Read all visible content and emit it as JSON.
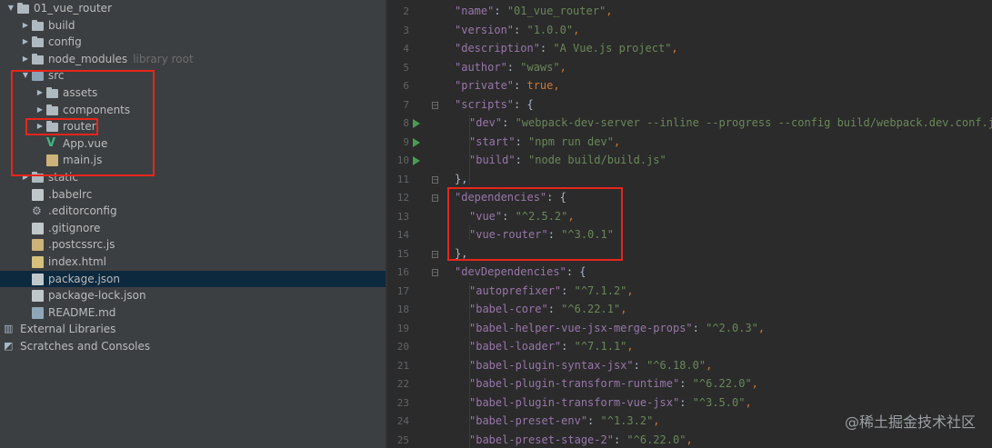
{
  "project_tree": {
    "items": [
      {
        "label": "01_vue_router",
        "depth": 0,
        "arrow": "down",
        "icon": "folder",
        "suffix": ""
      },
      {
        "label": "build",
        "depth": 1,
        "arrow": "right",
        "icon": "folder",
        "suffix": ""
      },
      {
        "label": "config",
        "depth": 1,
        "arrow": "right",
        "icon": "folder",
        "suffix": ""
      },
      {
        "label": "node_modules",
        "depth": 1,
        "arrow": "right",
        "icon": "folder",
        "suffix": "library root"
      },
      {
        "label": "src",
        "depth": 1,
        "arrow": "down",
        "icon": "folder-src",
        "suffix": ""
      },
      {
        "label": "assets",
        "depth": 2,
        "arrow": "right",
        "icon": "folder",
        "suffix": ""
      },
      {
        "label": "components",
        "depth": 2,
        "arrow": "right",
        "icon": "folder",
        "suffix": ""
      },
      {
        "label": "router",
        "depth": 2,
        "arrow": "right",
        "icon": "folder",
        "suffix": ""
      },
      {
        "label": "App.vue",
        "depth": 2,
        "arrow": "",
        "icon": "vue",
        "suffix": ""
      },
      {
        "label": "main.js",
        "depth": 2,
        "arrow": "",
        "icon": "js",
        "suffix": ""
      },
      {
        "label": "static",
        "depth": 1,
        "arrow": "right",
        "icon": "folder",
        "suffix": ""
      },
      {
        "label": ".babelrc",
        "depth": 1,
        "arrow": "",
        "icon": "json",
        "suffix": ""
      },
      {
        "label": ".editorconfig",
        "depth": 1,
        "arrow": "",
        "icon": "gear",
        "suffix": ""
      },
      {
        "label": ".gitignore",
        "depth": 1,
        "arrow": "",
        "icon": "json",
        "suffix": ""
      },
      {
        "label": ".postcssrc.js",
        "depth": 1,
        "arrow": "",
        "icon": "js",
        "suffix": ""
      },
      {
        "label": "index.html",
        "depth": 1,
        "arrow": "",
        "icon": "html",
        "suffix": ""
      },
      {
        "label": "package.json",
        "depth": 1,
        "arrow": "",
        "icon": "json",
        "suffix": "",
        "selected": true
      },
      {
        "label": "package-lock.json",
        "depth": 1,
        "arrow": "",
        "icon": "json",
        "suffix": ""
      },
      {
        "label": "README.md",
        "depth": 1,
        "arrow": "",
        "icon": "md",
        "suffix": ""
      },
      {
        "label": "External Libraries",
        "depth": 0,
        "arrow": "",
        "icon": "library",
        "suffix": ""
      },
      {
        "label": "Scratches and Consoles",
        "depth": 0,
        "arrow": "",
        "icon": "scratch",
        "suffix": ""
      }
    ]
  },
  "editor": {
    "lines": [
      {
        "n": "2",
        "tokens": [
          [
            "k",
            "\"name\""
          ],
          [
            "p",
            ": "
          ],
          [
            "s",
            "\"01_vue_router\""
          ],
          [
            "b",
            ","
          ]
        ],
        "indent": 1
      },
      {
        "n": "3",
        "tokens": [
          [
            "k",
            "\"version\""
          ],
          [
            "p",
            ": "
          ],
          [
            "s",
            "\"1.0.0\""
          ],
          [
            "b",
            ","
          ]
        ],
        "indent": 1
      },
      {
        "n": "4",
        "tokens": [
          [
            "k",
            "\"description\""
          ],
          [
            "p",
            ": "
          ],
          [
            "s",
            "\"A Vue.js project\""
          ],
          [
            "b",
            ","
          ]
        ],
        "indent": 1
      },
      {
        "n": "5",
        "tokens": [
          [
            "k",
            "\"author\""
          ],
          [
            "p",
            ": "
          ],
          [
            "s",
            "\"waws\""
          ],
          [
            "b",
            ","
          ]
        ],
        "indent": 1
      },
      {
        "n": "6",
        "tokens": [
          [
            "k",
            "\"private\""
          ],
          [
            "p",
            ": "
          ],
          [
            "b",
            "true,"
          ]
        ],
        "indent": 1
      },
      {
        "n": "7",
        "tokens": [
          [
            "k",
            "\"scripts\""
          ],
          [
            "p",
            ": {"
          ]
        ],
        "indent": 1,
        "fold": "open"
      },
      {
        "n": "8",
        "tokens": [
          [
            "k",
            "\"dev\""
          ],
          [
            "p",
            ": "
          ],
          [
            "s",
            "\"webpack-dev-server --inline --progress --config build/webpack.dev.conf.js\""
          ]
        ],
        "indent": 2,
        "run": true
      },
      {
        "n": "9",
        "tokens": [
          [
            "k",
            "\"start\""
          ],
          [
            "p",
            ": "
          ],
          [
            "s",
            "\"npm run dev\""
          ],
          [
            "b",
            ","
          ]
        ],
        "indent": 2,
        "run": true
      },
      {
        "n": "10",
        "tokens": [
          [
            "k",
            "\"build\""
          ],
          [
            "p",
            ": "
          ],
          [
            "s",
            "\"node build/build.js\""
          ]
        ],
        "indent": 2,
        "run": true
      },
      {
        "n": "11",
        "tokens": [
          [
            "p",
            "},"
          ]
        ],
        "indent": 1,
        "fold": "close"
      },
      {
        "n": "12",
        "tokens": [
          [
            "k",
            "\"dependencies\""
          ],
          [
            "p",
            ": {"
          ]
        ],
        "indent": 1,
        "fold": "open"
      },
      {
        "n": "13",
        "tokens": [
          [
            "k",
            "\"vue\""
          ],
          [
            "p",
            ": "
          ],
          [
            "s",
            "\"^2.5.2\""
          ],
          [
            "b",
            ","
          ]
        ],
        "indent": 2
      },
      {
        "n": "14",
        "tokens": [
          [
            "k",
            "\"vue-router\""
          ],
          [
            "p",
            ": "
          ],
          [
            "s",
            "\"^3.0.1\""
          ]
        ],
        "indent": 2
      },
      {
        "n": "15",
        "tokens": [
          [
            "p",
            "},"
          ]
        ],
        "indent": 1,
        "fold": "close"
      },
      {
        "n": "16",
        "tokens": [
          [
            "k",
            "\"devDependencies\""
          ],
          [
            "p",
            ": {"
          ]
        ],
        "indent": 1,
        "fold": "open"
      },
      {
        "n": "17",
        "tokens": [
          [
            "k",
            "\"autoprefixer\""
          ],
          [
            "p",
            ": "
          ],
          [
            "s",
            "\"^7.1.2\""
          ],
          [
            "b",
            ","
          ]
        ],
        "indent": 2
      },
      {
        "n": "18",
        "tokens": [
          [
            "k",
            "\"babel-core\""
          ],
          [
            "p",
            ": "
          ],
          [
            "s",
            "\"^6.22.1\""
          ],
          [
            "b",
            ","
          ]
        ],
        "indent": 2
      },
      {
        "n": "19",
        "tokens": [
          [
            "k",
            "\"babel-helper-vue-jsx-merge-props\""
          ],
          [
            "p",
            ": "
          ],
          [
            "s",
            "\"^2.0.3\""
          ],
          [
            "b",
            ","
          ]
        ],
        "indent": 2
      },
      {
        "n": "20",
        "tokens": [
          [
            "k",
            "\"babel-loader\""
          ],
          [
            "p",
            ": "
          ],
          [
            "s",
            "\"^7.1.1\""
          ],
          [
            "b",
            ","
          ]
        ],
        "indent": 2
      },
      {
        "n": "21",
        "tokens": [
          [
            "k",
            "\"babel-plugin-syntax-jsx\""
          ],
          [
            "p",
            ": "
          ],
          [
            "s",
            "\"^6.18.0\""
          ],
          [
            "b",
            ","
          ]
        ],
        "indent": 2
      },
      {
        "n": "22",
        "tokens": [
          [
            "k",
            "\"babel-plugin-transform-runtime\""
          ],
          [
            "p",
            ": "
          ],
          [
            "s",
            "\"^6.22.0\""
          ],
          [
            "b",
            ","
          ]
        ],
        "indent": 2
      },
      {
        "n": "23",
        "tokens": [
          [
            "k",
            "\"babel-plugin-transform-vue-jsx\""
          ],
          [
            "p",
            ": "
          ],
          [
            "s",
            "\"^3.5.0\""
          ],
          [
            "b",
            ","
          ]
        ],
        "indent": 2
      },
      {
        "n": "24",
        "tokens": [
          [
            "k",
            "\"babel-preset-env\""
          ],
          [
            "p",
            ": "
          ],
          [
            "s",
            "\"^1.3.2\""
          ],
          [
            "b",
            ","
          ]
        ],
        "indent": 2
      },
      {
        "n": "25",
        "tokens": [
          [
            "k",
            "\"babel-preset-stage-2\""
          ],
          [
            "p",
            ": "
          ],
          [
            "s",
            "\"^6.22.0\""
          ],
          [
            "b",
            ","
          ]
        ],
        "indent": 2
      }
    ]
  },
  "watermark": "@稀土掘金技术社区",
  "colors": {
    "highlight_box": "#e8251b",
    "selection": "#0d293e",
    "json_key": "#9876aa",
    "json_string": "#6a8759",
    "keyword": "#cc7832"
  }
}
